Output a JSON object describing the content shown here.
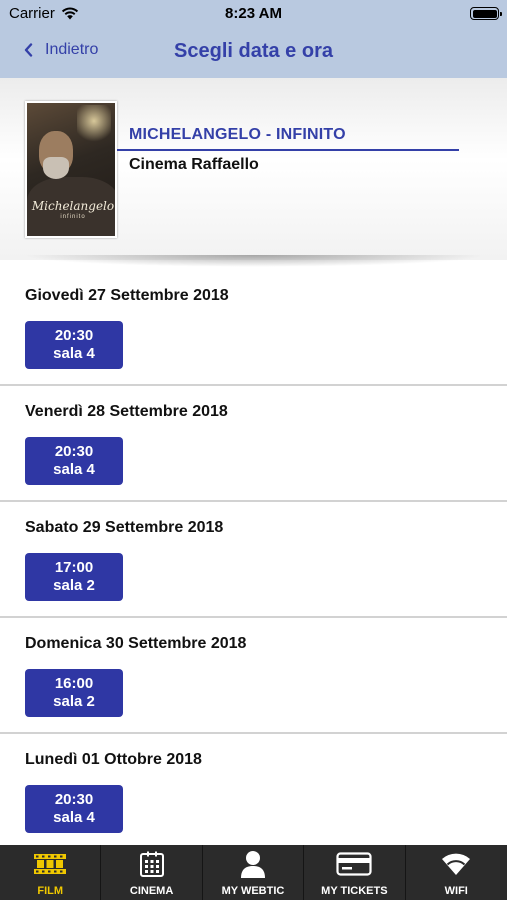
{
  "status": {
    "carrier": "Carrier",
    "time": "8:23 AM"
  },
  "nav": {
    "back_label": "Indietro",
    "title": "Scegli data e ora"
  },
  "movie": {
    "title": "MICHELANGELO - INFINITO",
    "cinema": "Cinema Raffaello",
    "poster_title": "Michelangelo",
    "poster_subtitle": "infinito"
  },
  "days": [
    {
      "date": "Giovedì 27 Settembre 2018",
      "time": "20:30",
      "room": "sala 4"
    },
    {
      "date": "Venerdì 28 Settembre 2018",
      "time": "20:30",
      "room": "sala 4"
    },
    {
      "date": "Sabato 29 Settembre 2018",
      "time": "17:00",
      "room": "sala 2"
    },
    {
      "date": "Domenica 30 Settembre 2018",
      "time": "16:00",
      "room": "sala 2"
    },
    {
      "date": "Lunedì 01 Ottobre 2018",
      "time": "20:30",
      "room": "sala 4"
    }
  ],
  "tabs": [
    {
      "label": "FILM",
      "icon": "film-icon",
      "active": true
    },
    {
      "label": "CINEMA",
      "icon": "building-icon",
      "active": false
    },
    {
      "label": "MY WEBTIC",
      "icon": "user-icon",
      "active": false
    },
    {
      "label": "MY TICKETS",
      "icon": "credit-card-icon",
      "active": false
    },
    {
      "label": "WIFI",
      "icon": "wifi-icon",
      "active": false
    }
  ],
  "colors": {
    "nav_background": "#b9c9e0",
    "accent_blue": "#3440a8",
    "button_blue": "#2f37a4",
    "tabbar_background": "#2b2b2b",
    "active_tab": "#f0c800"
  }
}
